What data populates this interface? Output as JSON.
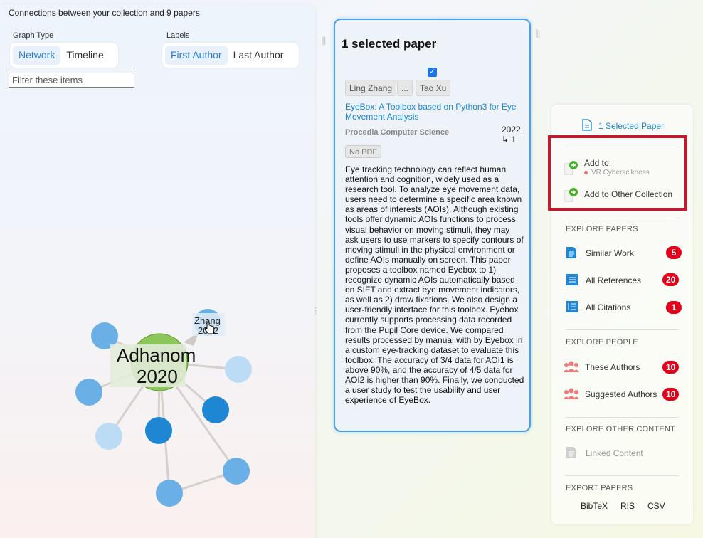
{
  "graph": {
    "title": "Connections between your collection and 9 papers",
    "graph_type_label": "Graph Type",
    "graph_types": [
      "Network",
      "Timeline"
    ],
    "labels_label": "Labels",
    "label_modes": [
      "First Author",
      "Last Author"
    ],
    "filter_placeholder": "Filter these items",
    "center_node": {
      "line1": "Adhanom",
      "line2": "2020"
    },
    "hover_node": {
      "line1": "Zhang",
      "line2": "2022"
    }
  },
  "card": {
    "title": "1 selected paper",
    "authors": [
      "Ling Zhang",
      "...",
      "Tao Xu"
    ],
    "paper_title": "EyeBox: A Toolbox based on Python3 for Eye Movement Analysis",
    "journal": "Procedia Computer Science",
    "year": "2022",
    "citations": "↳ 1",
    "no_pdf": "No PDF",
    "abstract": "Eye tracking technology can reflect human attention and cognition, widely used as a research tool. To analyze eye movement data, users need to determine a specific area known as areas of interests (AOIs). Although existing tools offer dynamic AOIs functions to process visual behavior on moving stimuli, they may ask users to use markers to specify contours of moving stimuli in the physical environment or define AOIs manually on screen. This paper proposes a toolbox named Eyebox to 1) recognize dynamic AOIs automatically based on SIFT and extract eye movement indicators, as well as 2) draw fixations. We also design a user-friendly interface for this toolbox. Eyebox currently supports processing data recorded from the Pupil Core device. We compared results processed by manual with by Eyebox in a custom eye-tracking dataset to evaluate this toolbox. The accuracy of 3/4 data for AOI1 is above 90%, and the accuracy of 4/5 data for AOI2 is higher than 90%. Finally, we conducted a user study to test the usability and user experience of EyeBox."
  },
  "sidebar": {
    "selected": "1 Selected Paper",
    "add_to": "Add to:",
    "collection": "VR Cyberscikness",
    "add_other": "Add to Other Collection",
    "explore_papers": "EXPLORE PAPERS",
    "similar_work": "Similar Work",
    "similar_count": "5",
    "all_references": "All References",
    "references_count": "20",
    "all_citations": "All Citations",
    "citations_count": "1",
    "explore_people": "EXPLORE PEOPLE",
    "these_authors": "These Authors",
    "these_count": "10",
    "suggested_authors": "Suggested Authors",
    "suggested_count": "10",
    "explore_other": "EXPLORE OTHER CONTENT",
    "linked_content": "Linked Content",
    "export_papers": "EXPORT PAPERS",
    "export_formats": [
      "BibTeX",
      "RIS",
      "CSV"
    ]
  },
  "colors": {
    "accent": "#1a84d3",
    "badge": "#e3001b",
    "highlight_box": "#c0182c",
    "node_blue": "#6aafe6",
    "node_dark": "#1f86d4",
    "node_light": "#bcdcf5",
    "node_green": "#8cc65a"
  }
}
